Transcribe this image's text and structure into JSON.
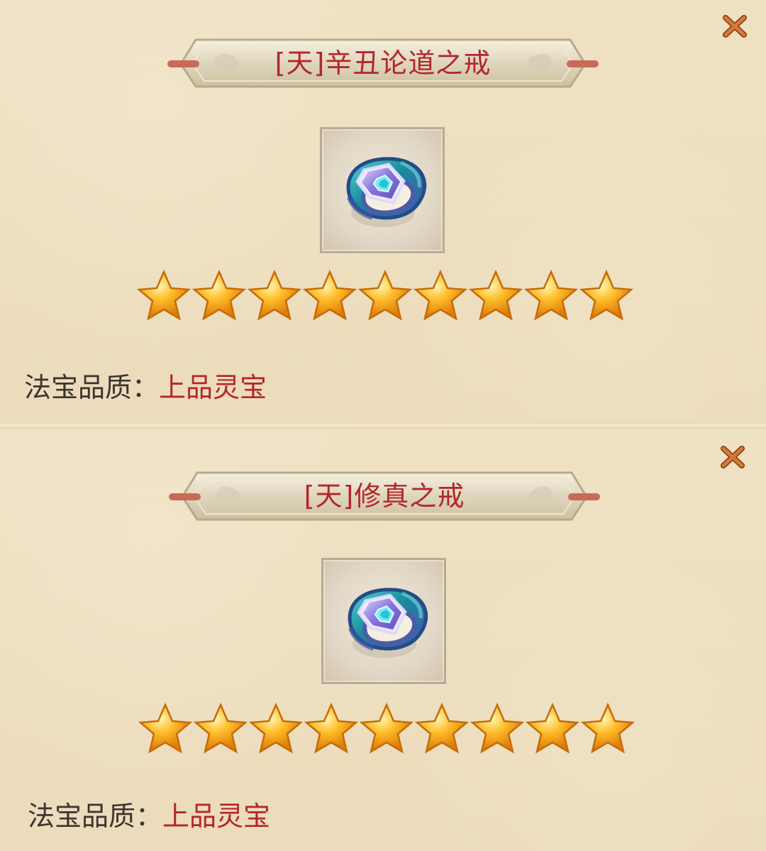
{
  "items": [
    {
      "title": "[天]辛丑论道之戒",
      "close_icon": "close-icon",
      "item_icon": "ring-icon",
      "stars": 9,
      "quality_label": "法宝品质：",
      "quality_value": "上品灵宝"
    },
    {
      "title": "[天]修真之戒",
      "close_icon": "close-icon",
      "item_icon": "ring-icon",
      "stars": 9,
      "quality_label": "法宝品质：",
      "quality_value": "上品灵宝"
    }
  ],
  "colors": {
    "background": "#eee0c2",
    "title": "#b3262b",
    "label": "#3b3430",
    "value": "#b3262b",
    "star": "#f5a81c",
    "close": "#c96a2c"
  }
}
